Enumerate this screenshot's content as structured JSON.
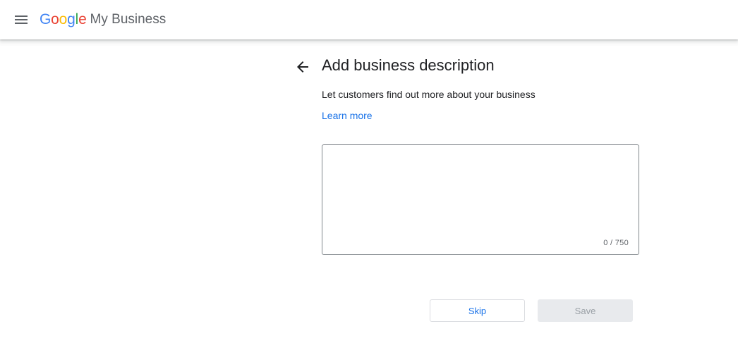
{
  "header": {
    "menu_icon": "hamburger-menu-icon",
    "logo": {
      "google_letters": [
        {
          "char": "G",
          "color": "#4285F4"
        },
        {
          "char": "o",
          "color": "#EA4335"
        },
        {
          "char": "o",
          "color": "#FBBC05"
        },
        {
          "char": "g",
          "color": "#4285F4"
        },
        {
          "char": "l",
          "color": "#34A853"
        },
        {
          "char": "e",
          "color": "#EA4335"
        }
      ],
      "product": "My Business"
    }
  },
  "main": {
    "back_icon": "arrow-back-icon",
    "title": "Add business description",
    "subtitle": "Let customers find out more about your business",
    "learn_more": "Learn more",
    "description": {
      "value": "",
      "counter": "0 / 750"
    },
    "buttons": {
      "skip": "Skip",
      "save": "Save"
    }
  },
  "colors": {
    "accent": "#1a73e8",
    "text": "#202124",
    "muted": "#5f6368",
    "disabled_bg": "#e8eaed"
  }
}
